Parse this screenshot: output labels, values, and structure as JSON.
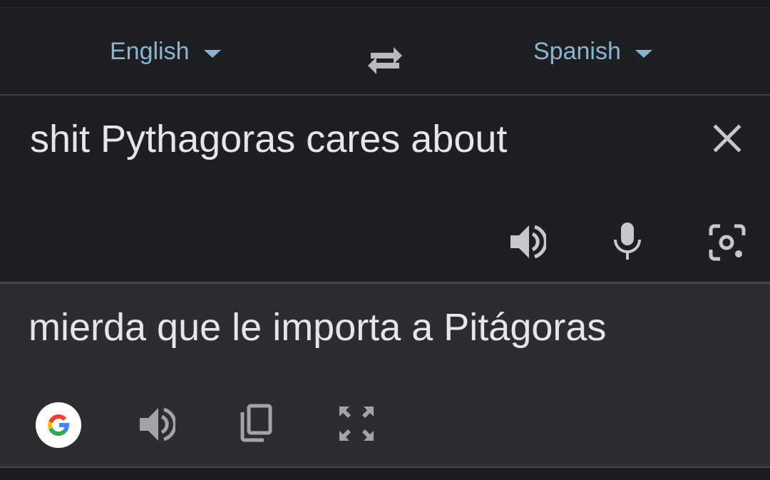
{
  "language_bar": {
    "source_language": "English",
    "target_language": "Spanish"
  },
  "source": {
    "text": "shit Pythagoras cares about"
  },
  "translation": {
    "text": "mierda que le importa a Pitágoras"
  },
  "colors": {
    "background": "#1e1f23",
    "translation_panel": "#2c2d31",
    "accent": "#8ab4d0",
    "text": "#e6e6e8",
    "icon": "#c8c8cc",
    "icon_muted": "#a3a4a8"
  },
  "icons": [
    "caret-down-icon",
    "swap-icon",
    "close-icon",
    "speaker-icon",
    "microphone-icon",
    "camera-icon",
    "google-logo-icon",
    "copy-icon",
    "fullscreen-icon"
  ]
}
